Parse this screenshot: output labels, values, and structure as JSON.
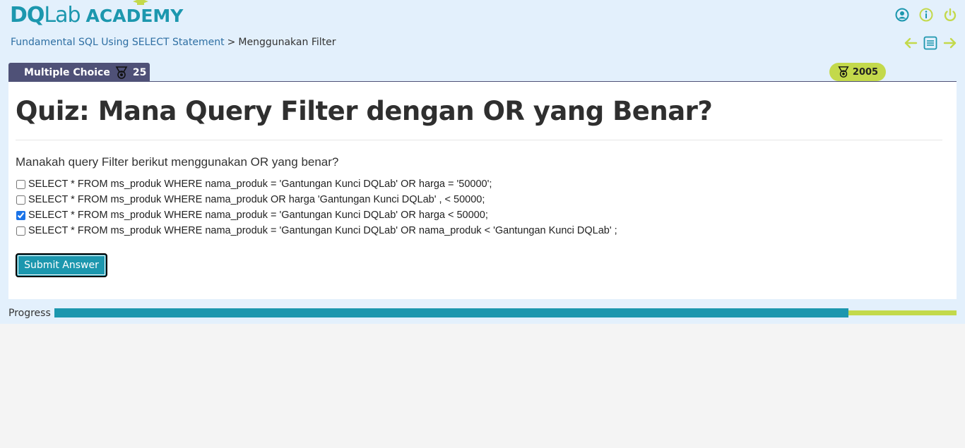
{
  "logo": {
    "dq": "DQ",
    "lab": "Lab",
    "academy": "ACADEMY"
  },
  "header_icons": [
    "user-icon",
    "info-icon",
    "power-icon"
  ],
  "breadcrumb": {
    "course": "Fundamental SQL Using SELECT Statement",
    "separator": ">",
    "current": "Menggunakan Filter"
  },
  "nav_icons": [
    "arrow-left-icon",
    "list-icon",
    "arrow-right-icon"
  ],
  "tab": {
    "label": "Multiple Choice",
    "points": "25"
  },
  "score": {
    "value": "2005"
  },
  "quiz": {
    "title": "Quiz: Mana Query Filter dengan OR yang Benar?",
    "question": "Manakah query Filter berikut menggunakan OR yang benar?",
    "options": [
      {
        "text": "SELECT * FROM ms_produk WHERE nama_produk = 'Gantungan Kunci DQLab' OR harga = '50000';",
        "checked": false
      },
      {
        "text": "SELECT * FROM ms_produk WHERE nama_produk OR harga 'Gantungan Kunci DQLab' , < 50000;",
        "checked": false
      },
      {
        "text": "SELECT * FROM ms_produk WHERE nama_produk = 'Gantungan Kunci DQLab' OR harga < 50000;",
        "checked": true
      },
      {
        "text": "SELECT * FROM ms_produk WHERE nama_produk = 'Gantungan Kunci DQLab' OR nama_produk < 'Gantungan Kunci DQLab' ;",
        "checked": false
      }
    ],
    "submit_label": "Submit Answer"
  },
  "progress": {
    "label": "Progress",
    "fraction": 0.88
  },
  "colors": {
    "teal": "#1c97ae",
    "lime": "#c3d94b",
    "tab": "#4f5177",
    "header_bg": "#e3f0fc"
  }
}
